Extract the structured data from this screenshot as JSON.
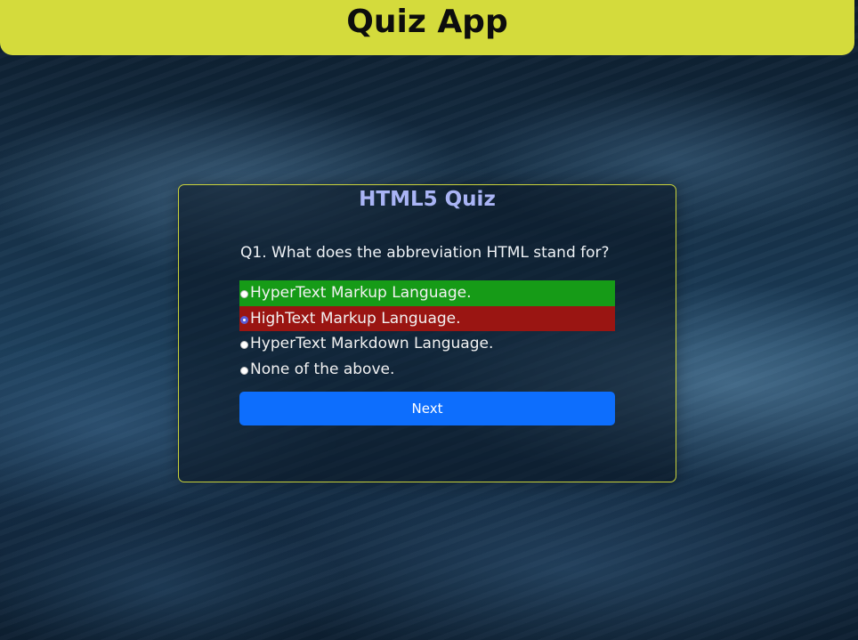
{
  "header": {
    "title": "Quiz App",
    "color": "#d4db3c"
  },
  "quiz": {
    "title": "HTML5 Quiz",
    "question": "Q1. What does the abbreviation HTML stand for?",
    "options": [
      {
        "label": "HyperText Markup Language.",
        "state": "correct",
        "selected": false
      },
      {
        "label": "HighText Markup Language.",
        "state": "wrong",
        "selected": true
      },
      {
        "label": "HyperText Markdown Language.",
        "state": "neutral",
        "selected": false
      },
      {
        "label": "None of the above.",
        "state": "neutral",
        "selected": false
      }
    ],
    "next_label": "Next",
    "colors": {
      "correct": "#169b17",
      "wrong": "#9a1512",
      "button": "#0d6efd",
      "title": "#a9b4f5",
      "card_border": "#c9d23a"
    }
  }
}
